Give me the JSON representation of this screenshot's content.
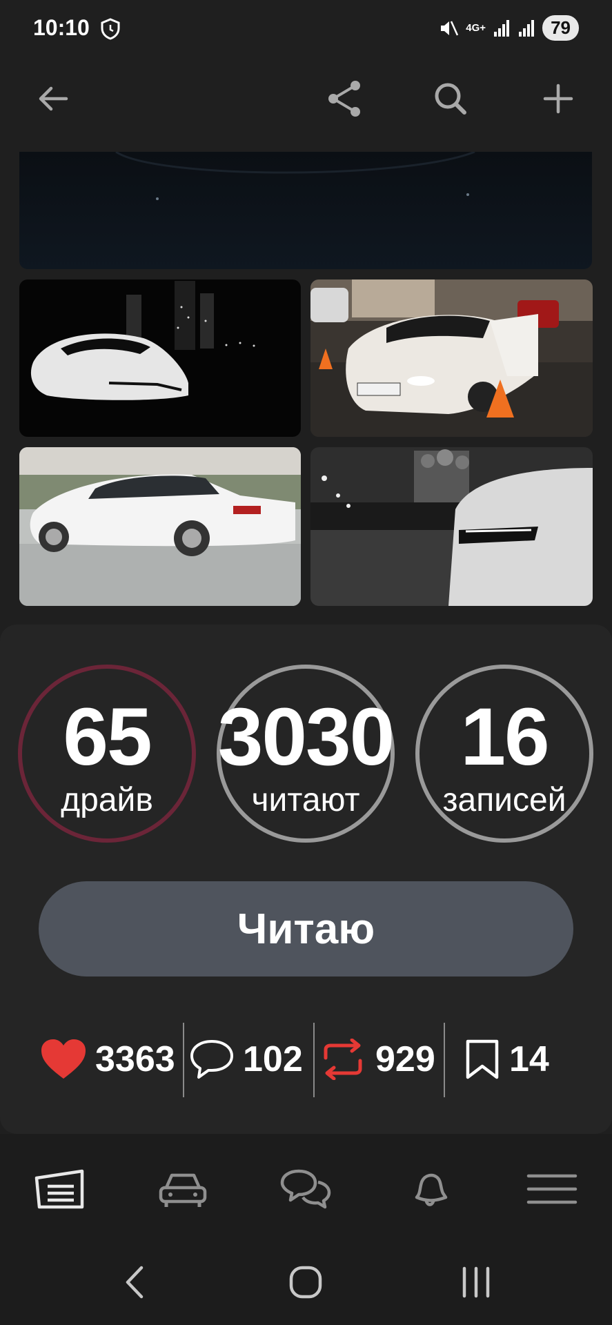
{
  "status_bar": {
    "time": "10:10",
    "network": "4G+",
    "battery": "79"
  },
  "stats": [
    {
      "value": "65",
      "label": "драйв",
      "ring_color": "#6b2538"
    },
    {
      "value": "3030",
      "label": "читают",
      "ring_color": "#9a9a9a"
    },
    {
      "value": "16",
      "label": "записей",
      "ring_color": "#9a9a9a"
    }
  ],
  "follow_button": {
    "label": "Читаю"
  },
  "metrics": {
    "likes": "3363",
    "comments": "102",
    "reposts": "929",
    "bookmarks": "14"
  },
  "colors": {
    "accent_red": "#e53935",
    "button_bg": "#4f545d",
    "card_bg": "#252525",
    "page_bg": "#1f1f1f"
  },
  "icons": {
    "top_bar": [
      "back-arrow-icon",
      "share-icon",
      "search-icon",
      "plus-icon"
    ],
    "bottom_nav": [
      "garage-icon",
      "car-icon",
      "chat-icon",
      "bell-icon",
      "menu-icon"
    ],
    "system_nav": [
      "back-icon",
      "home-icon",
      "recents-icon"
    ]
  }
}
